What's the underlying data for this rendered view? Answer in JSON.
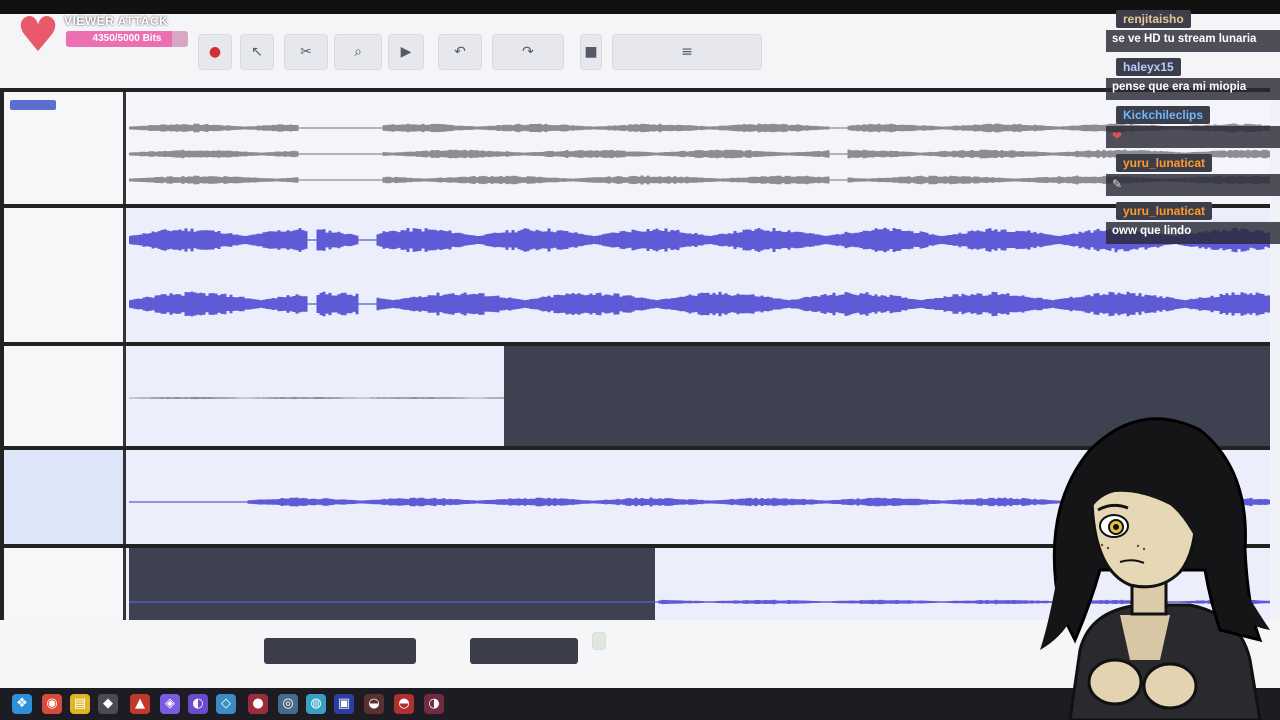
{
  "overlay": {
    "title": "VIEWER ATTACK",
    "bits_text": "4350/5000 Bits",
    "bits_current": 4350,
    "bits_max": 5000,
    "heart_icon": "heart-icon",
    "bar_color": "#ec6fb2"
  },
  "chat": [
    {
      "user": "renjitaisho",
      "color": "#e7c89a",
      "text": "se ve HD tu stream lunaria"
    },
    {
      "user": "haleyx15",
      "color": "#b9c9ff",
      "text": "pense que era mi miopia"
    },
    {
      "user": "Kickchileclips",
      "color": "#6fb6ff",
      "text": "",
      "emote": "emote-icon"
    },
    {
      "user": "yuru_lunaticat",
      "color": "#ff9a2e",
      "text": "",
      "emote": "emote-icon"
    },
    {
      "user": "yuru_lunaticat",
      "color": "#ff9a2e",
      "text": "oww que lindo"
    }
  ],
  "colors": {
    "waveform": "#5f5bd6",
    "waveform_muted": "#8c8c92",
    "empty_region": "#3e4150"
  },
  "icons": {
    "toolbar": [
      "record-icon",
      "play-icon",
      "stop-icon",
      "cut-icon",
      "zoom-icon",
      "undo-icon",
      "redo-icon",
      "mixer-icon"
    ],
    "taskbar": [
      "app-icon-1",
      "app-icon-2",
      "app-icon-3",
      "app-icon-4",
      "app-icon-5",
      "app-icon-6",
      "app-icon-7",
      "app-icon-8",
      "app-icon-9",
      "app-icon-10",
      "app-icon-11",
      "app-icon-12",
      "app-icon-13",
      "app-icon-14"
    ]
  }
}
